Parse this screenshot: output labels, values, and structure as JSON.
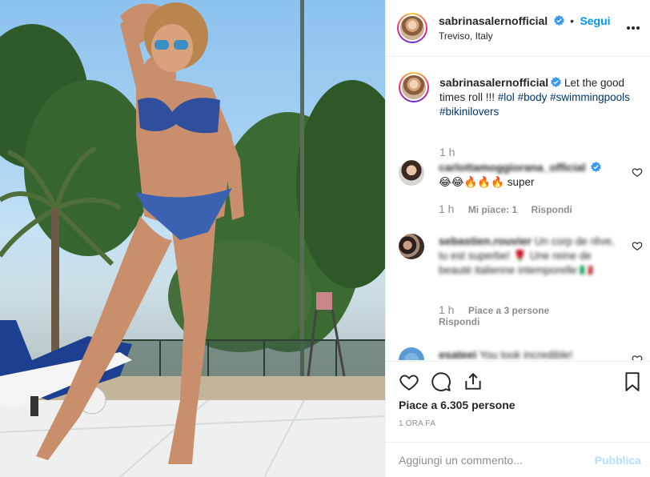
{
  "post": {
    "username": "sabrinasalernofficial",
    "follow_label": "Segui",
    "separator": "•",
    "location": "Treviso, Italy",
    "more_icon": "more-horizontal-icon"
  },
  "caption": {
    "username": "sabrinasalernofficial",
    "text": "Let the good times roll !!!",
    "hashtags": [
      "#lol",
      "#body",
      "#swimmingpools",
      "#bikinilovers"
    ],
    "time": "1 h"
  },
  "comments": [
    {
      "username": "carlottamoggiorana_official",
      "text": "😂😂🔥🔥🔥 super",
      "time": "1 h",
      "likes": "Mi piace: 1",
      "reply": "Rispondi"
    },
    {
      "username": "sebastien.rouvier",
      "text": "Un corp de rêve, tu est superbe! 🌹 Une reine de beauté italienne intemporelle 🇮🇹",
      "time": "1 h",
      "likes": "Piace a 3 persone",
      "reply": "Rispondi"
    },
    {
      "username": "esateei",
      "text": "You look incredible!"
    }
  ],
  "footer": {
    "likes": "Piace a 6.305 persone",
    "timestamp": "1 ORA FA",
    "comment_placeholder": "Aggiungi un commento...",
    "publish_label": "Pubblica"
  },
  "colors": {
    "link": "#0095f6",
    "hashtag": "#00376b",
    "muted": "#8e8e8e",
    "publish_disabled": "#b2dffc"
  }
}
